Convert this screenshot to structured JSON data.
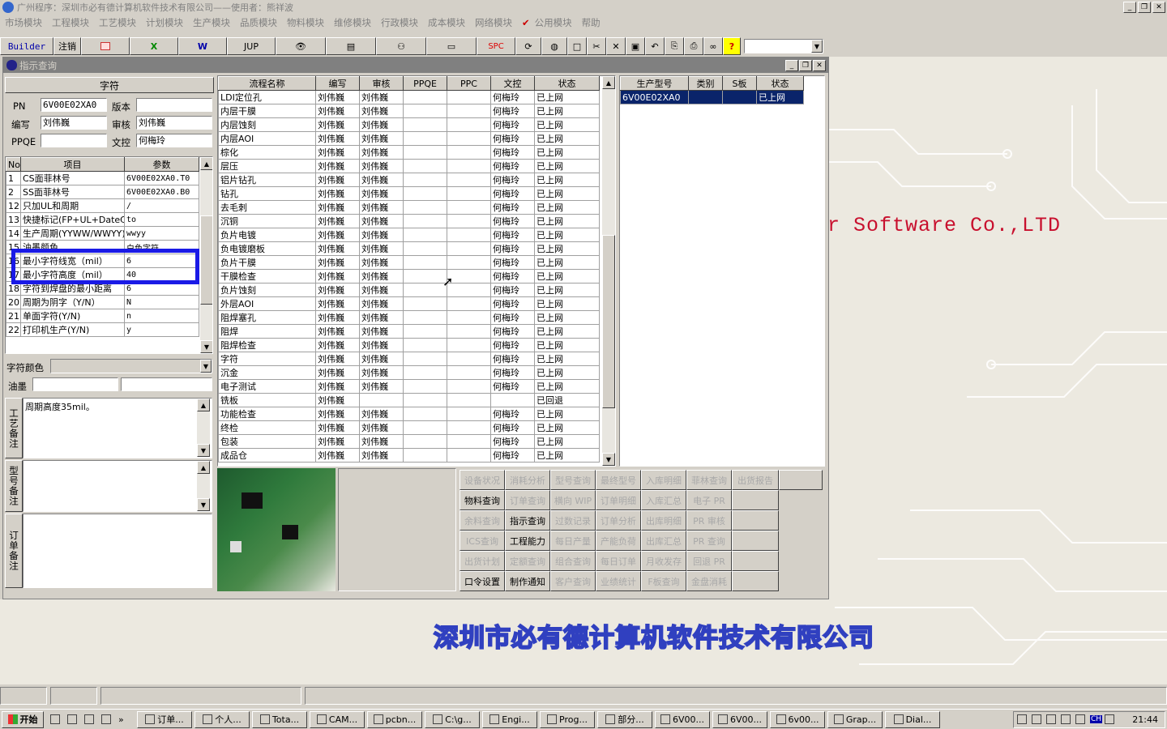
{
  "app": {
    "title": "广州程序：深圳市必有德计算机软件技术有限公司——使用者：熊祥波"
  },
  "menu": [
    "市场模块",
    "工程模块",
    "工艺模块",
    "计划模块",
    "生产模块",
    "品质模块",
    "物料模块",
    "维修模块",
    "行政模块",
    "成本模块",
    "网络模块",
    "公用模块",
    "帮助"
  ],
  "toolbar": {
    "builder": "Builder",
    "logout": "注销",
    "jup": "JUP",
    "spc": "SPC"
  },
  "window": {
    "title": "指示查询"
  },
  "char_panel": {
    "header": "字符",
    "pn_label": "PN",
    "pn_value": "6V00E02XA0",
    "version_label": "版本",
    "version_value": "",
    "author_label": "编写",
    "author_value": "刘伟巍",
    "review_label": "审核",
    "review_value": "刘伟巍",
    "ppqe_label": "PPQE",
    "ppqe_value": "",
    "dc_label": "文控",
    "dc_value": "何梅玲"
  },
  "params": {
    "headers": [
      "No",
      "项目",
      "参数"
    ],
    "rows": [
      [
        "1",
        "CS面菲林号",
        "6V00E02XA0.T0"
      ],
      [
        "2",
        "SS面菲林号",
        "6V00E02XA0.B0"
      ],
      [
        "12",
        "只加UL和周期",
        "/"
      ],
      [
        "13",
        "快捷标记(FP+UL+DateCo",
        "to"
      ],
      [
        "14",
        "生产周期(YYWW/WWYY)",
        "wwyy"
      ],
      [
        "15",
        "油墨颜色",
        "白色字符"
      ],
      [
        "16",
        "最小字符线宽（mil）",
        "6"
      ],
      [
        "17",
        "最小字符高度（mil）",
        "40"
      ],
      [
        "18",
        "字符到焊盘的最小距离",
        "6"
      ],
      [
        "20",
        "周期为阴字（Y/N）",
        "N"
      ],
      [
        "21",
        "单面字符(Y/N)",
        "n"
      ],
      [
        "22",
        "打印机生产(Y/N)",
        "y"
      ]
    ]
  },
  "char_color": {
    "label": "字符颜色",
    "value": ""
  },
  "ink": {
    "label": "油墨",
    "value1": "",
    "value2": ""
  },
  "notes": {
    "process_label": "工艺备注",
    "process_value": "周期高度35mil。",
    "model_label": "型号备注",
    "model_value": "",
    "order_label": "订单备注",
    "order_value": ""
  },
  "flow": {
    "headers": [
      "流程名称",
      "编写",
      "审核",
      "PPQE",
      "PPC",
      "文控",
      "状态"
    ],
    "rows": [
      [
        "LDI定位孔",
        "刘伟巍",
        "刘伟巍",
        "",
        "",
        "何梅玲",
        "已上网"
      ],
      [
        "内层干膜",
        "刘伟巍",
        "刘伟巍",
        "",
        "",
        "何梅玲",
        "已上网"
      ],
      [
        "内层蚀刻",
        "刘伟巍",
        "刘伟巍",
        "",
        "",
        "何梅玲",
        "已上网"
      ],
      [
        "内层AOI",
        "刘伟巍",
        "刘伟巍",
        "",
        "",
        "何梅玲",
        "已上网"
      ],
      [
        "棕化",
        "刘伟巍",
        "刘伟巍",
        "",
        "",
        "何梅玲",
        "已上网"
      ],
      [
        "层压",
        "刘伟巍",
        "刘伟巍",
        "",
        "",
        "何梅玲",
        "已上网"
      ],
      [
        "铝片钻孔",
        "刘伟巍",
        "刘伟巍",
        "",
        "",
        "何梅玲",
        "已上网"
      ],
      [
        "钻孔",
        "刘伟巍",
        "刘伟巍",
        "",
        "",
        "何梅玲",
        "已上网"
      ],
      [
        "去毛刺",
        "刘伟巍",
        "刘伟巍",
        "",
        "",
        "何梅玲",
        "已上网"
      ],
      [
        "沉铜",
        "刘伟巍",
        "刘伟巍",
        "",
        "",
        "何梅玲",
        "已上网"
      ],
      [
        "负片电镀",
        "刘伟巍",
        "刘伟巍",
        "",
        "",
        "何梅玲",
        "已上网"
      ],
      [
        "负电镀磨板",
        "刘伟巍",
        "刘伟巍",
        "",
        "",
        "何梅玲",
        "已上网"
      ],
      [
        "负片干膜",
        "刘伟巍",
        "刘伟巍",
        "",
        "",
        "何梅玲",
        "已上网"
      ],
      [
        "干膜检查",
        "刘伟巍",
        "刘伟巍",
        "",
        "",
        "何梅玲",
        "已上网"
      ],
      [
        "负片蚀刻",
        "刘伟巍",
        "刘伟巍",
        "",
        "",
        "何梅玲",
        "已上网"
      ],
      [
        "外层AOI",
        "刘伟巍",
        "刘伟巍",
        "",
        "",
        "何梅玲",
        "已上网"
      ],
      [
        "阻焊塞孔",
        "刘伟巍",
        "刘伟巍",
        "",
        "",
        "何梅玲",
        "已上网"
      ],
      [
        "阻焊",
        "刘伟巍",
        "刘伟巍",
        "",
        "",
        "何梅玲",
        "已上网"
      ],
      [
        "阻焊检查",
        "刘伟巍",
        "刘伟巍",
        "",
        "",
        "何梅玲",
        "已上网"
      ],
      [
        "字符",
        "刘伟巍",
        "刘伟巍",
        "",
        "",
        "何梅玲",
        "已上网"
      ],
      [
        "沉金",
        "刘伟巍",
        "刘伟巍",
        "",
        "",
        "何梅玲",
        "已上网"
      ],
      [
        "电子测试",
        "刘伟巍",
        "刘伟巍",
        "",
        "",
        "何梅玲",
        "已上网"
      ],
      [
        "铣板",
        "刘伟巍",
        "",
        "",
        "",
        "",
        "已回退"
      ],
      [
        "功能检查",
        "刘伟巍",
        "刘伟巍",
        "",
        "",
        "何梅玲",
        "已上网"
      ],
      [
        "终检",
        "刘伟巍",
        "刘伟巍",
        "",
        "",
        "何梅玲",
        "已上网"
      ],
      [
        "包装",
        "刘伟巍",
        "刘伟巍",
        "",
        "",
        "何梅玲",
        "已上网"
      ],
      [
        "成品仓",
        "刘伟巍",
        "刘伟巍",
        "",
        "",
        "何梅玲",
        "已上网"
      ]
    ]
  },
  "models": {
    "headers": [
      "生产型号",
      "类别",
      "S板",
      "状态"
    ],
    "rows": [
      [
        "6V00E02XA0",
        "",
        "",
        "已上网"
      ]
    ]
  },
  "func_buttons": [
    [
      "设备状况",
      "消耗分析",
      "型号查询",
      "最终型号",
      "入库明细",
      "菲林查询",
      "出货报告",
      ""
    ],
    [
      "物料查询",
      "订单查询",
      "横向 WIP",
      "订单明细",
      "入库汇总",
      "电子 PR",
      ""
    ],
    [
      "余料查询",
      "指示查询",
      "过数记录",
      "订单分析",
      "出库明细",
      "PR 审核",
      ""
    ],
    [
      "ICS查询",
      "工程能力",
      "每日产量",
      "产能负荷",
      "出库汇总",
      "PR 查询",
      ""
    ],
    [
      "出货计划",
      "定额查询",
      "组合查询",
      "每日订单",
      "月收发存",
      "回退 PR",
      ""
    ],
    [
      "口令设置",
      "制作通知",
      "客户查询",
      "业绩统计",
      "F板查询",
      "金盘消耗",
      ""
    ]
  ],
  "func_enabled": [
    "物料查询",
    "指示查询",
    "工程能力",
    "口令设置",
    "制作通知"
  ],
  "desktop": {
    "brand_en": "er Software Co.,LTD",
    "brand_cn": "深圳市必有德计算机软件技术有限公司"
  },
  "taskbar": {
    "start": "开始",
    "tasks": [
      "订单...",
      "个人...",
      "Tota...",
      "CAM...",
      "pcbn...",
      "C:\\g...",
      "Engi...",
      "Prog...",
      "部分...",
      "6V00...",
      "6V00...",
      "6v00...",
      "Grap...",
      "Dial..."
    ],
    "clock": "21:44",
    "ime": "CH"
  }
}
